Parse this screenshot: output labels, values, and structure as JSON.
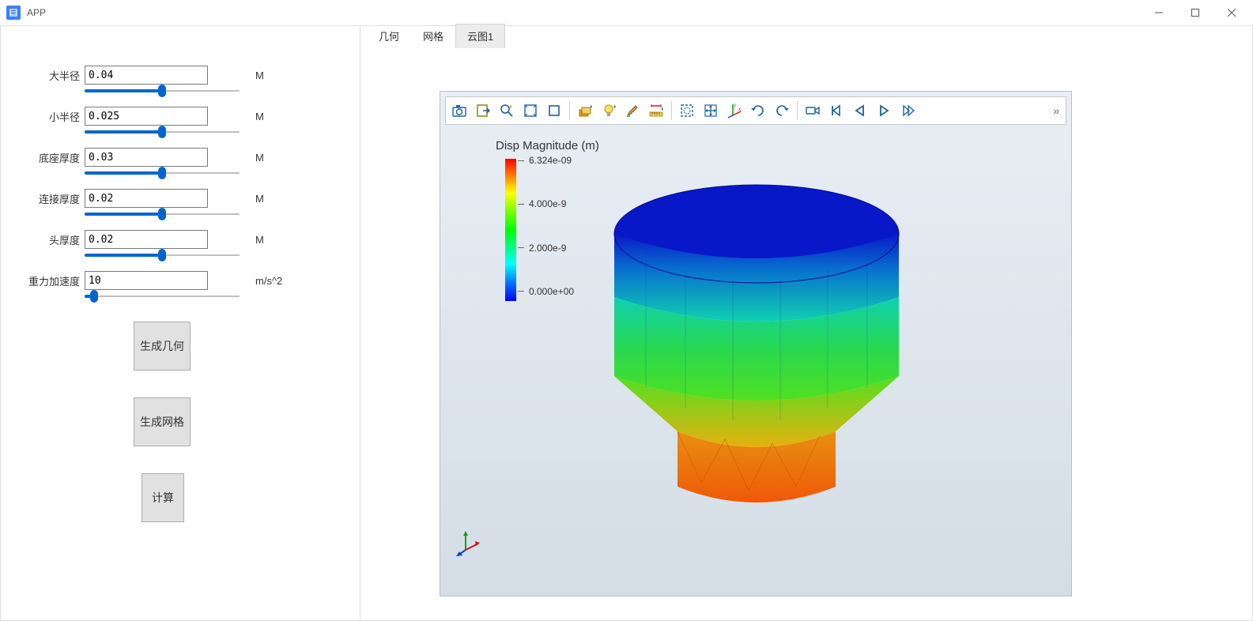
{
  "window": {
    "title": "APP"
  },
  "tabs": [
    {
      "label": "几何",
      "active": false
    },
    {
      "label": "网格",
      "active": false
    },
    {
      "label": "云图1",
      "active": true
    }
  ],
  "params": [
    {
      "label": "大半径",
      "value": "0.04",
      "unit": "M",
      "slider_pct": 50
    },
    {
      "label": "小半径",
      "value": "0.025",
      "unit": "M",
      "slider_pct": 50
    },
    {
      "label": "底座厚度",
      "value": "0.03",
      "unit": "M",
      "slider_pct": 50
    },
    {
      "label": "连接厚度",
      "value": "0.02",
      "unit": "M",
      "slider_pct": 50
    },
    {
      "label": "头厚度",
      "value": "0.02",
      "unit": "M",
      "slider_pct": 50
    },
    {
      "label": "重力加速度",
      "value": "10",
      "unit": "m/s^2",
      "slider_pct": 6
    }
  ],
  "buttons": {
    "gen_geometry": "生成几何",
    "gen_mesh": "生成网格",
    "calculate": "计算"
  },
  "legend": {
    "title": "Disp Magnitude (m)",
    "ticks": [
      "6.324e-09",
      "4.000e-9",
      "2.000e-9",
      "0.000e+00"
    ]
  },
  "toolbar_icons": [
    "camera-icon",
    "export-icon",
    "zoom-find-icon",
    "fit-icon",
    "box-icon",
    "layers-icon",
    "lightbulb-icon",
    "brush-icon",
    "ruler-icon",
    "dashed-select-icon",
    "move-icon",
    "axes-icon",
    "rotate-cw-icon",
    "rotate-ccw-icon",
    "video-icon",
    "skip-back-icon",
    "play-back-icon",
    "play-forward-icon",
    "skip-forward-icon"
  ],
  "overflow_glyph": "»"
}
